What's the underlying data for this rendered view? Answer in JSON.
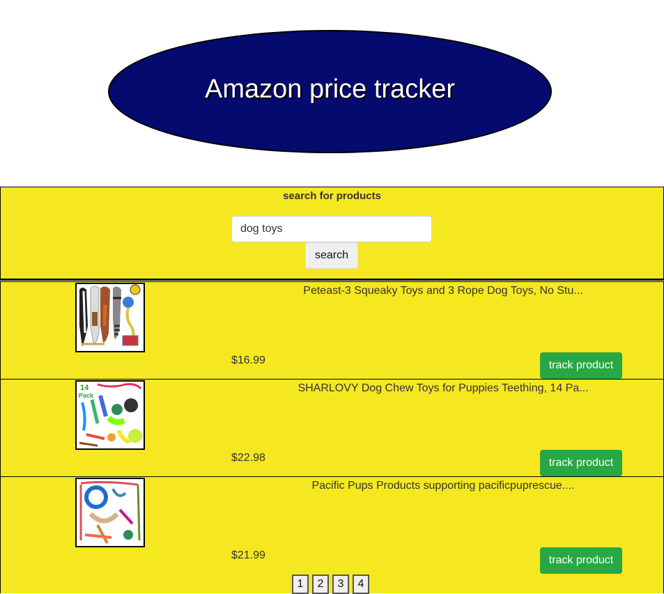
{
  "header": {
    "title": "Amazon price tracker"
  },
  "search": {
    "section_title": "search for products",
    "input_value": "dog toys",
    "button_label": "search"
  },
  "products": [
    {
      "title": "Peteast-3 Squeaky Toys and 3 Rope Dog Toys, No Stu...",
      "price": "$16.99",
      "button_label": "track product"
    },
    {
      "title": "SHARLOVY Dog Chew Toys for Puppies Teething, 14 Pa...",
      "price": "$22.98",
      "button_label": "track product",
      "image_text": "14 Pack"
    },
    {
      "title": "Pacific Pups Products supporting pacificpuprescue....",
      "price": "$21.99",
      "button_label": "track product"
    }
  ],
  "pagination": {
    "pages": [
      "1",
      "2",
      "3",
      "4"
    ]
  },
  "colors": {
    "header_oval": "#050a6e",
    "panel_background": "#f5e820",
    "track_button": "#28a745"
  }
}
